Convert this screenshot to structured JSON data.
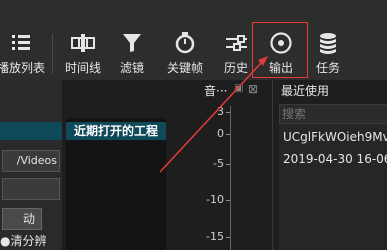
{
  "toolbar": {
    "items": [
      {
        "label": "播放列表",
        "icon": "playlist-icon"
      },
      {
        "label": "时间线",
        "icon": "timeline-icon"
      },
      {
        "label": "滤镜",
        "icon": "filter-icon"
      },
      {
        "label": "关键帧",
        "icon": "keyframes-icon"
      },
      {
        "label": "历史",
        "icon": "history-icon"
      },
      {
        "label": "输出",
        "icon": "export-disc-icon"
      },
      {
        "label": "任务",
        "icon": "jobs-database-icon"
      }
    ]
  },
  "left_panel": {
    "path_value": "/Videos",
    "button_label": "动",
    "bottom_label": "清分辨"
  },
  "projects_panel": {
    "title": "近期打开的工程"
  },
  "audio_meter": {
    "title": "音···",
    "ticks": [
      "3",
      "0",
      "-5",
      "-10",
      "-15"
    ]
  },
  "recent_panel": {
    "title": "最近使用",
    "search_placeholder": "搜索",
    "items": [
      "UCglFkWOieh9Mv",
      "2019-04-30 16-06"
    ]
  },
  "colors": {
    "highlight": "#e53a3a",
    "panel_header": "#0f4a5a"
  }
}
